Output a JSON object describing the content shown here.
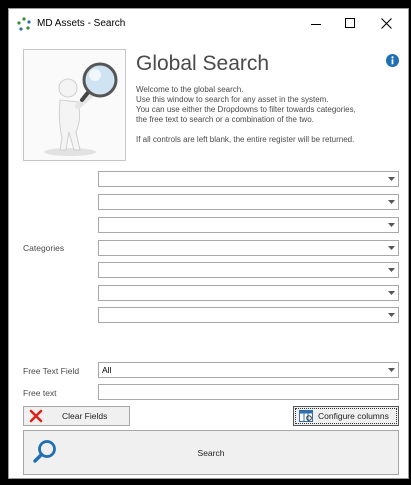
{
  "window": {
    "title": "MD Assets - Search",
    "controls": {
      "minimize": "–",
      "maximize": "□",
      "close": "✕"
    }
  },
  "header": {
    "heading": "Global Search",
    "description": [
      "Welcome to the global search.",
      "Use this window to search for any asset in the system.",
      "You can use either the Dropdowns to filter towards categories,",
      "the free text to search or a combination of the two."
    ],
    "note": "If all controls are left blank, the entire register will be returned."
  },
  "categories": {
    "label": "Categories",
    "dropdowns": [
      "",
      "",
      "",
      "",
      "",
      "",
      "",
      ""
    ]
  },
  "free_text_field": {
    "label": "Free Text Field",
    "value": "All"
  },
  "free_text": {
    "label": "Free text",
    "value": ""
  },
  "buttons": {
    "clear": "Clear Fields",
    "configure": "Configure columns",
    "search": "Search"
  },
  "colors": {
    "accent": "#1f6fb2",
    "clear_red": "#d9261c"
  }
}
